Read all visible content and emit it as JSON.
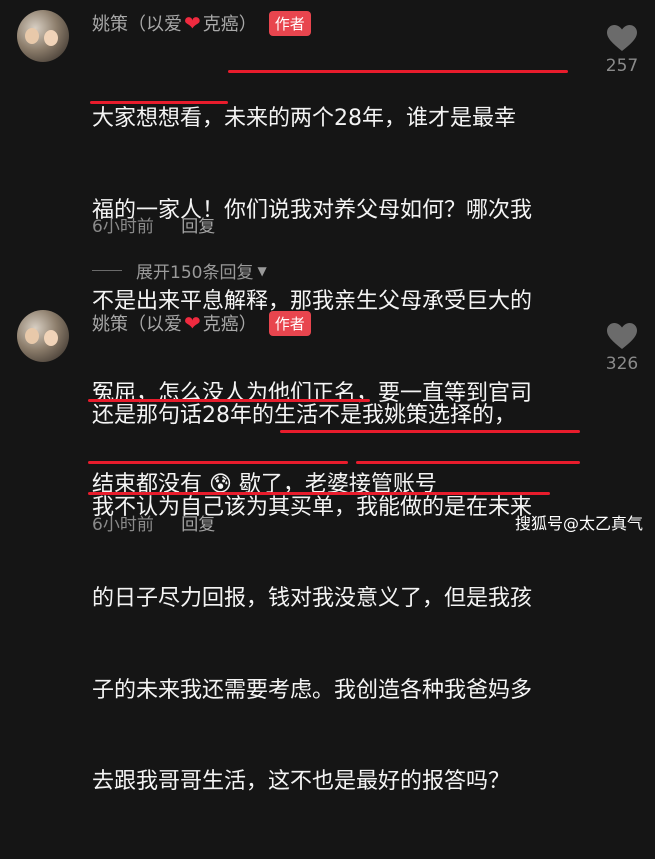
{
  "comments": [
    {
      "name_prefix": "姚策（以爱",
      "name_suffix": "克癌）",
      "badge": "作者",
      "text_lines": [
        "大家想想看，未来的两个28年，谁才是最幸",
        "福的一家人！你们说我对养父母如何？哪次我",
        "不是出来平息解释，那我亲生父母承受巨大的",
        "冤屈，怎么没人为他们正名，要一直等到官司",
        "结束都没有 😰 歇了，老婆接管账号"
      ],
      "time": "6小时前",
      "reply": "回复",
      "likes": "257"
    },
    {
      "name_prefix": "姚策（以爱",
      "name_suffix": "克癌）",
      "badge": "作者",
      "text_lines": [
        "还是那句话28年的生活不是我姚策选择的，",
        "我不认为自己该为其买单，我能做的是在未来",
        "的日子尽力回报，钱对我没意义了，但是我孩",
        "子的未来我还需要考虑。我创造各种我爸妈多",
        "去跟我哥哥生活，这不也是最好的报答吗？"
      ],
      "time": "6小时前",
      "reply": "回复",
      "likes": "326"
    }
  ],
  "expand_label": "展开150条回复",
  "watermark": "搜狐号@太乙真气",
  "colors": {
    "accent": "#e8454e",
    "underline": "#e81c2c",
    "heart": "#ef2a3f"
  }
}
